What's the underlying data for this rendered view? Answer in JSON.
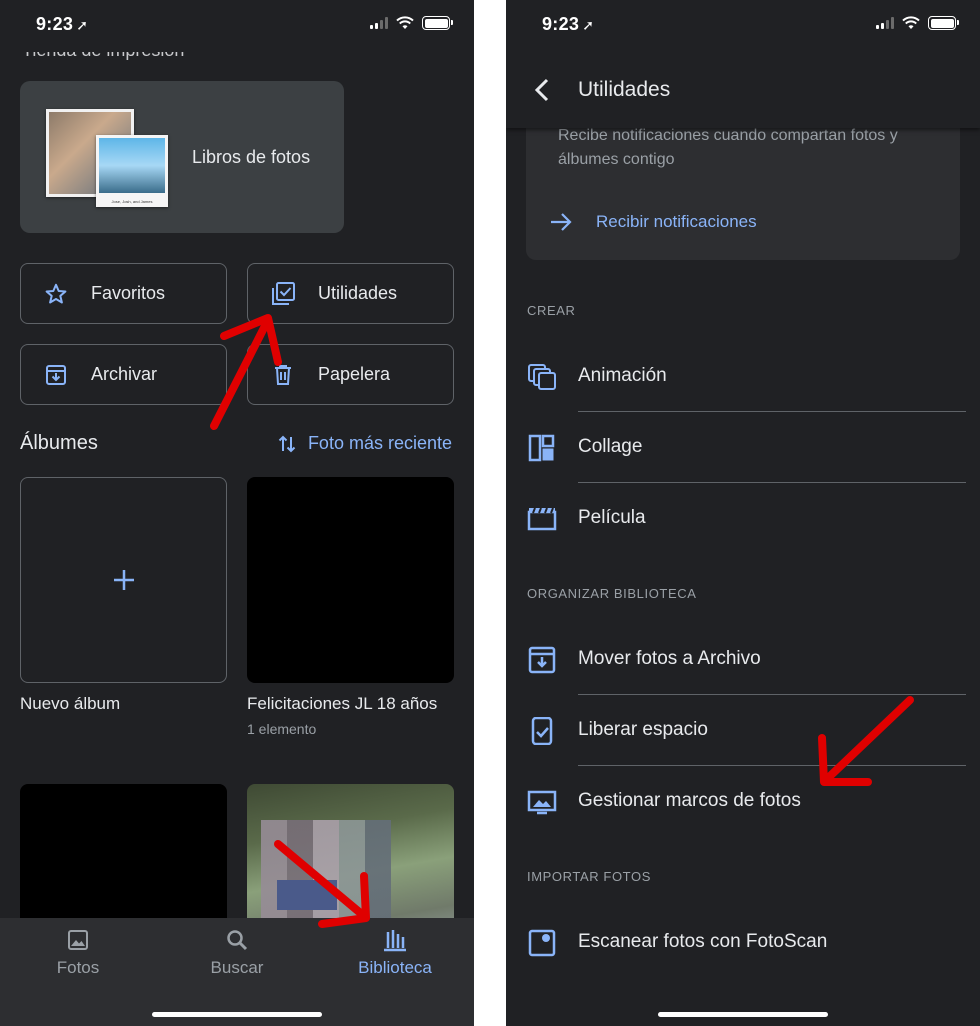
{
  "status_bar": {
    "time": "9:23"
  },
  "left": {
    "cut_title": "Tienda de impresión",
    "book": {
      "label": "Libros de fotos",
      "caption": "Jose, Josh, and James"
    },
    "chips": [
      {
        "label": "Favoritos"
      },
      {
        "label": "Utilidades"
      },
      {
        "label": "Archivar"
      },
      {
        "label": "Papelera"
      }
    ],
    "albums_header": "Álbumes",
    "sort_label": "Foto más reciente",
    "albums": [
      {
        "title": "Nuevo álbum"
      },
      {
        "title": "Felicitaciones JL 18 años",
        "count": "1 elemento"
      }
    ],
    "nav": [
      {
        "label": "Fotos",
        "icon": "photo-icon"
      },
      {
        "label": "Buscar",
        "icon": "search-icon"
      },
      {
        "label": "Biblioteca",
        "icon": "library-icon",
        "active": true
      }
    ]
  },
  "right": {
    "title": "Utilidades",
    "notif": {
      "text": "Recibe notificaciones cuando compartan fotos y álbumes contigo",
      "action": "Recibir notificaciones"
    },
    "sections": {
      "create": "CREAR",
      "organize": "ORGANIZAR BIBLIOTECA",
      "import": "IMPORTAR FOTOS"
    },
    "create_items": [
      {
        "label": "Animación",
        "icon": "animation-icon"
      },
      {
        "label": "Collage",
        "icon": "collage-icon"
      },
      {
        "label": "Película",
        "icon": "movie-icon"
      }
    ],
    "organize_items": [
      {
        "label": "Mover fotos a Archivo",
        "icon": "archive-icon"
      },
      {
        "label": "Liberar espacio",
        "icon": "free-space-icon"
      },
      {
        "label": "Gestionar marcos de fotos",
        "icon": "photo-frame-icon"
      }
    ],
    "import_items": [
      {
        "label": "Escanear fotos con FotoScan",
        "icon": "photoscan-icon"
      }
    ]
  },
  "colors": {
    "accent": "#8ab4f8",
    "background": "#202124",
    "annotation_arrow": "#e00000"
  }
}
